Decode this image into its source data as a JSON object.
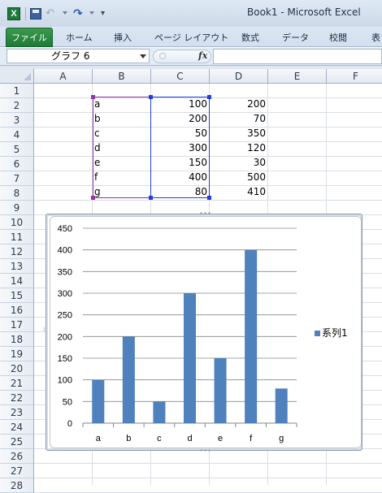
{
  "window": {
    "title": "Book1  -  Microsoft Excel",
    "app_icon": "excel-icon",
    "quick_access": [
      "save-icon",
      "redo-icon",
      "undo-icon",
      "customize-icon"
    ]
  },
  "ribbon": {
    "file_tab": "ファイル",
    "tabs": [
      "ホーム",
      "挿入",
      "ページ レイアウト",
      "数式",
      "データ",
      "校閲",
      "表"
    ]
  },
  "formula_bar": {
    "name_box": "グラフ 6",
    "fx_label": "fx",
    "formula": ""
  },
  "sheet": {
    "columns": [
      "A",
      "B",
      "C",
      "D",
      "E",
      "F"
    ],
    "rows": [
      "1",
      "2",
      "3",
      "4",
      "5",
      "6",
      "7",
      "8",
      "9",
      "10",
      "11",
      "12",
      "13",
      "14",
      "15",
      "16",
      "17",
      "18",
      "19",
      "20",
      "21",
      "22",
      "23",
      "24",
      "25",
      "26",
      "27",
      "28"
    ],
    "data": [
      {
        "row": "2",
        "b": "a",
        "c": "100",
        "d": "200"
      },
      {
        "row": "3",
        "b": "b",
        "c": "200",
        "d": "70"
      },
      {
        "row": "4",
        "b": "c",
        "c": "50",
        "d": "350"
      },
      {
        "row": "5",
        "b": "d",
        "c": "300",
        "d": "120"
      },
      {
        "row": "6",
        "b": "e",
        "c": "150",
        "d": "30"
      },
      {
        "row": "7",
        "b": "f",
        "c": "400",
        "d": "500"
      },
      {
        "row": "8",
        "b": "g",
        "c": "80",
        "d": "410"
      }
    ],
    "selection_colors": {
      "category_range": "#9932a8",
      "value_range": "#1f3fd6"
    }
  },
  "chart_data": {
    "type": "bar",
    "categories": [
      "a",
      "b",
      "c",
      "d",
      "e",
      "f",
      "g"
    ],
    "series": [
      {
        "name": "系列1",
        "values": [
          100,
          200,
          50,
          300,
          150,
          400,
          80
        ]
      }
    ],
    "yticks": [
      "0",
      "50",
      "100",
      "150",
      "200",
      "250",
      "300",
      "350",
      "400",
      "450"
    ],
    "ylim": [
      0,
      450
    ],
    "grid": true,
    "legend": "right",
    "bar_color": "#4f81bd"
  }
}
